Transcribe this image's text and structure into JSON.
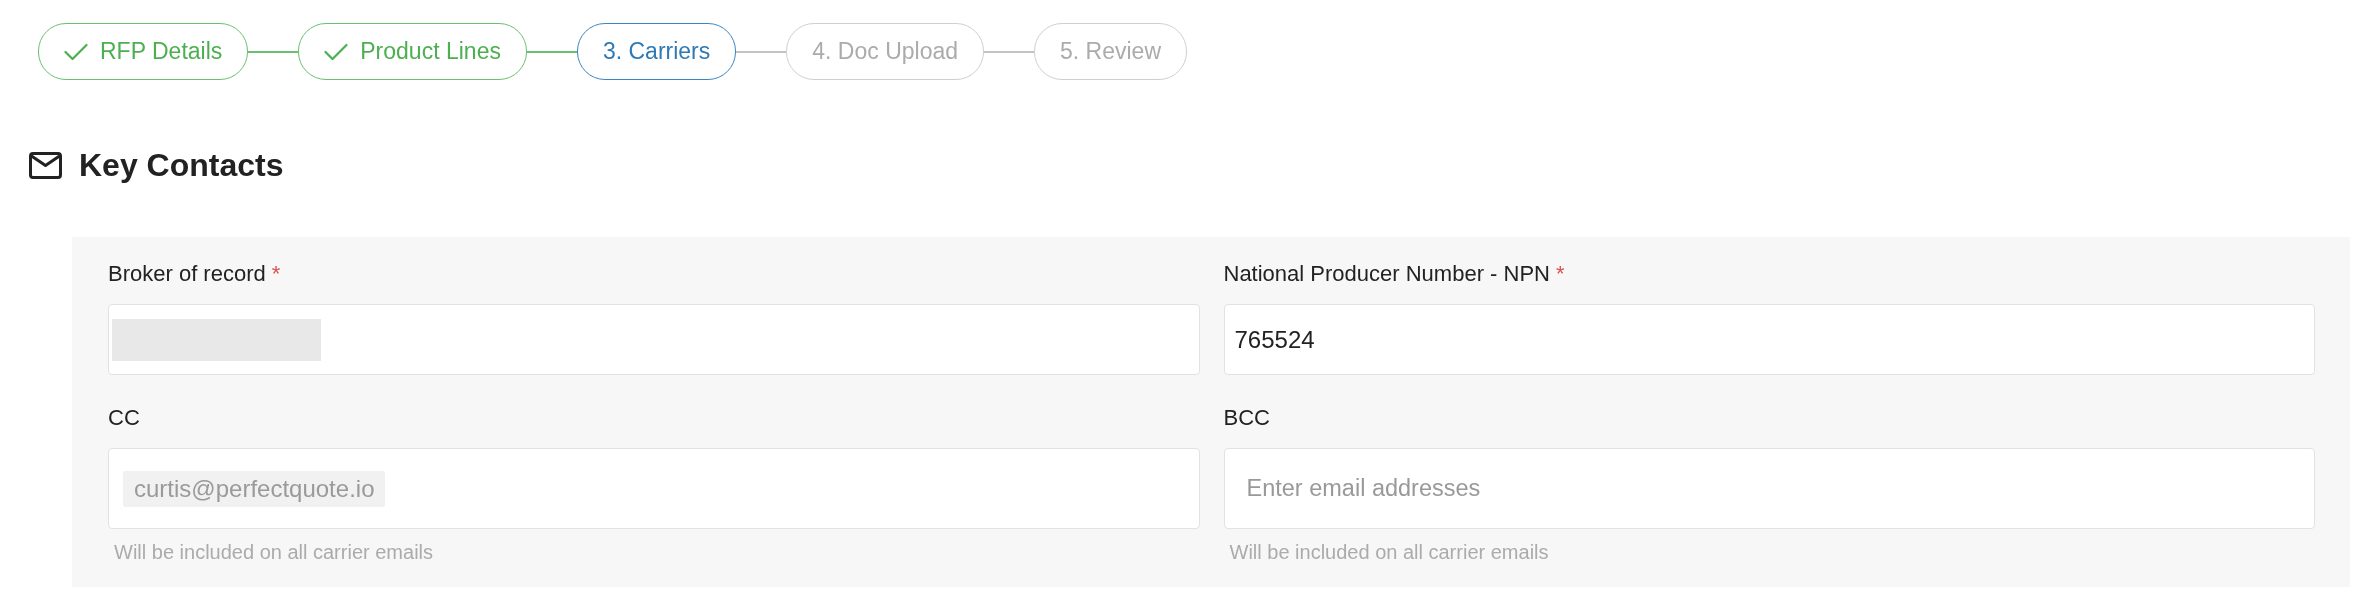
{
  "stepper": {
    "steps": [
      {
        "label": "RFP Details",
        "completed": true,
        "selected": false
      },
      {
        "label": "Product Lines",
        "completed": true,
        "selected": false
      },
      {
        "label": "3. Carriers",
        "completed": false,
        "selected": true
      },
      {
        "label": "4. Doc Upload",
        "completed": false,
        "selected": false
      },
      {
        "label": "5. Review",
        "completed": false,
        "selected": false
      }
    ]
  },
  "section": {
    "title": "Key Contacts"
  },
  "fields": [
    {
      "label": "Broker of record",
      "required_mark": "*",
      "kind": "text",
      "redacted": true
    },
    {
      "label": "National Producer Number - NPN",
      "required_mark": "*",
      "kind": "text",
      "value": "765524"
    },
    {
      "label": "CC",
      "kind": "email_tags",
      "tags": [
        "curtis@perfectquote.io"
      ],
      "helper": "Will be included on all carrier emails"
    },
    {
      "label": "BCC",
      "kind": "email_tags",
      "placeholder": "Enter email addresses",
      "helper": "Will be included on all carrier emails"
    }
  ]
}
